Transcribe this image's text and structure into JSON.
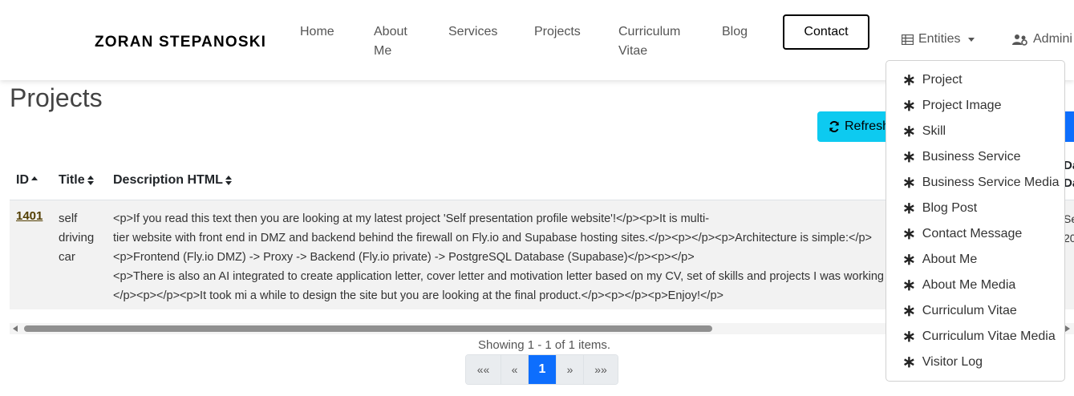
{
  "navbar": {
    "brand": "ZORAN STEPANOSKI",
    "links": [
      "Home",
      "About Me",
      "Services",
      "Projects",
      "Curriculum Vitae",
      "Blog"
    ],
    "contact": "Contact",
    "entities": "Entities",
    "admin": "Admini"
  },
  "page": {
    "title": "Projects",
    "refresh_label": "Refresh"
  },
  "table": {
    "headers": {
      "id": "ID",
      "title": "Title",
      "description": "Description HTML",
      "extra": "Da\nDa"
    },
    "row": {
      "id": "1401",
      "title_lines": [
        "self",
        "driving",
        "car"
      ],
      "desc_lines": [
        "<p>If you read this text then you are looking at my latest project 'Self presentation profile website'!</p><p>It is multi-",
        "tier website with front end in DMZ and backend behind the firewall on Fly.io and Supabase hosting sites.</p><p></p><p>Architecture is simple:</p>",
        "<p>Frontend (Fly.io DMZ) -> Proxy -> Backend (Fly.io private) -> PostgreSQL Database (Supabase)</p><p></p>",
        "<p>There is also an AI integrated to create application letter, cover letter and motivation letter based on my CV, set of skills and projects I was working on.",
        "</p><p></p><p>It took mi a while to design the site but you are looking at the final product.</p><p></p><p>Enjoy!</p>"
      ],
      "extra_lines": [
        "Se",
        "20"
      ]
    }
  },
  "pagination": {
    "showing": "Showing 1 - 1 of 1 items.",
    "first": "««",
    "prev": "«",
    "current": "1",
    "next": "»",
    "last": "»»"
  },
  "dropdown": {
    "items": [
      "Project",
      "Project Image",
      "Skill",
      "Business Service",
      "Business Service Media",
      "Blog Post",
      "Contact Message",
      "About Me",
      "About Me Media",
      "Curriculum Vitae",
      "Curriculum Vitae Media",
      "Visitor Log"
    ]
  }
}
